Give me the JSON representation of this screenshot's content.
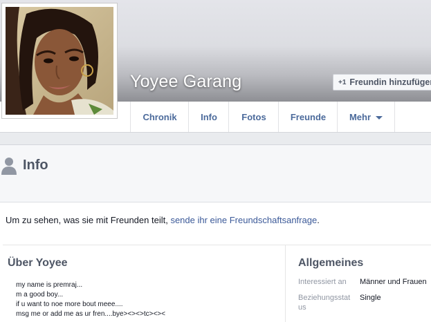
{
  "profile": {
    "name": "Yoyee Garang",
    "add_friend_icon": "+1",
    "add_friend_label": "Freundin hinzufügen"
  },
  "nav": {
    "tabs": [
      "Chronik",
      "Info",
      "Fotos",
      "Freunde",
      "Mehr"
    ]
  },
  "info": {
    "icon": "person-icon",
    "title": "Info",
    "notice_text": "Um zu sehen, was sie mit Freunden teilt, ",
    "notice_link": "sende ihr eine Freundschaftsanfrage",
    "notice_end": "."
  },
  "about": {
    "title": "Über Yoyee",
    "lines": [
      "my name is premraj...",
      "m a good boy...",
      "if u want to noe more bout meee....",
      "msg me or add me as ur fren....bye><><>tc><><"
    ]
  },
  "general": {
    "title": "Allgemeines",
    "rows": [
      {
        "label": "Interessiert an",
        "value": "Männer und Frauen"
      },
      {
        "label": "Beziehungsstatus",
        "value": "Single"
      }
    ]
  },
  "colors": {
    "link": "#3b5998",
    "tab_text": "#4b6a9b",
    "heading": "#4e5665"
  }
}
